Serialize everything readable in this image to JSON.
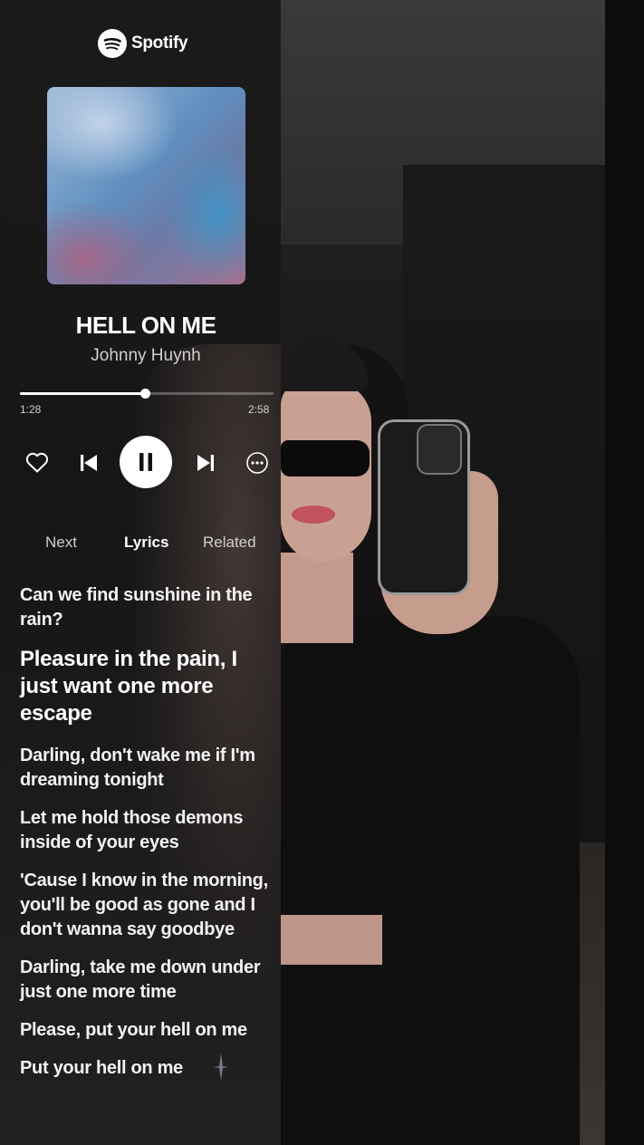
{
  "app": {
    "brand": "Spotify"
  },
  "track": {
    "title": "HELL ON ME",
    "artist": "Johnny Huynh"
  },
  "playback": {
    "elapsed": "1:28",
    "total": "2:58",
    "progress_fraction": 0.494,
    "state": "playing"
  },
  "controls": {
    "like_icon": "heart-outline-icon",
    "prev_icon": "skip-previous-icon",
    "play_icon": "pause-icon",
    "next_icon": "skip-next-icon",
    "more_icon": "more-options-icon"
  },
  "tabs": [
    {
      "label": "Next",
      "active": false
    },
    {
      "label": "Lyrics",
      "active": true
    },
    {
      "label": "Related",
      "active": false
    }
  ],
  "lyrics": [
    {
      "text": "Can we find sunshine in the rain?",
      "current": false
    },
    {
      "text": "Pleasure in the pain, I just want one more escape",
      "current": true
    },
    {
      "text": "Darling, don't wake me if I'm dreaming tonight",
      "current": false
    },
    {
      "text": "Let me hold those demons inside of your eyes",
      "current": false
    },
    {
      "text": "'Cause I know in the morning, you'll be good as gone and I don't wanna say goodbye",
      "current": false
    },
    {
      "text": "Darling, take me down under just one more time",
      "current": false
    },
    {
      "text": "Please, put your hell on me",
      "current": false
    },
    {
      "text": "Put your hell on me",
      "current": false
    }
  ],
  "colors": {
    "panel_bg": "#1a1a1a",
    "text_primary": "#ffffff",
    "text_secondary": "#cfcfcf",
    "accent": "#ffffff"
  }
}
